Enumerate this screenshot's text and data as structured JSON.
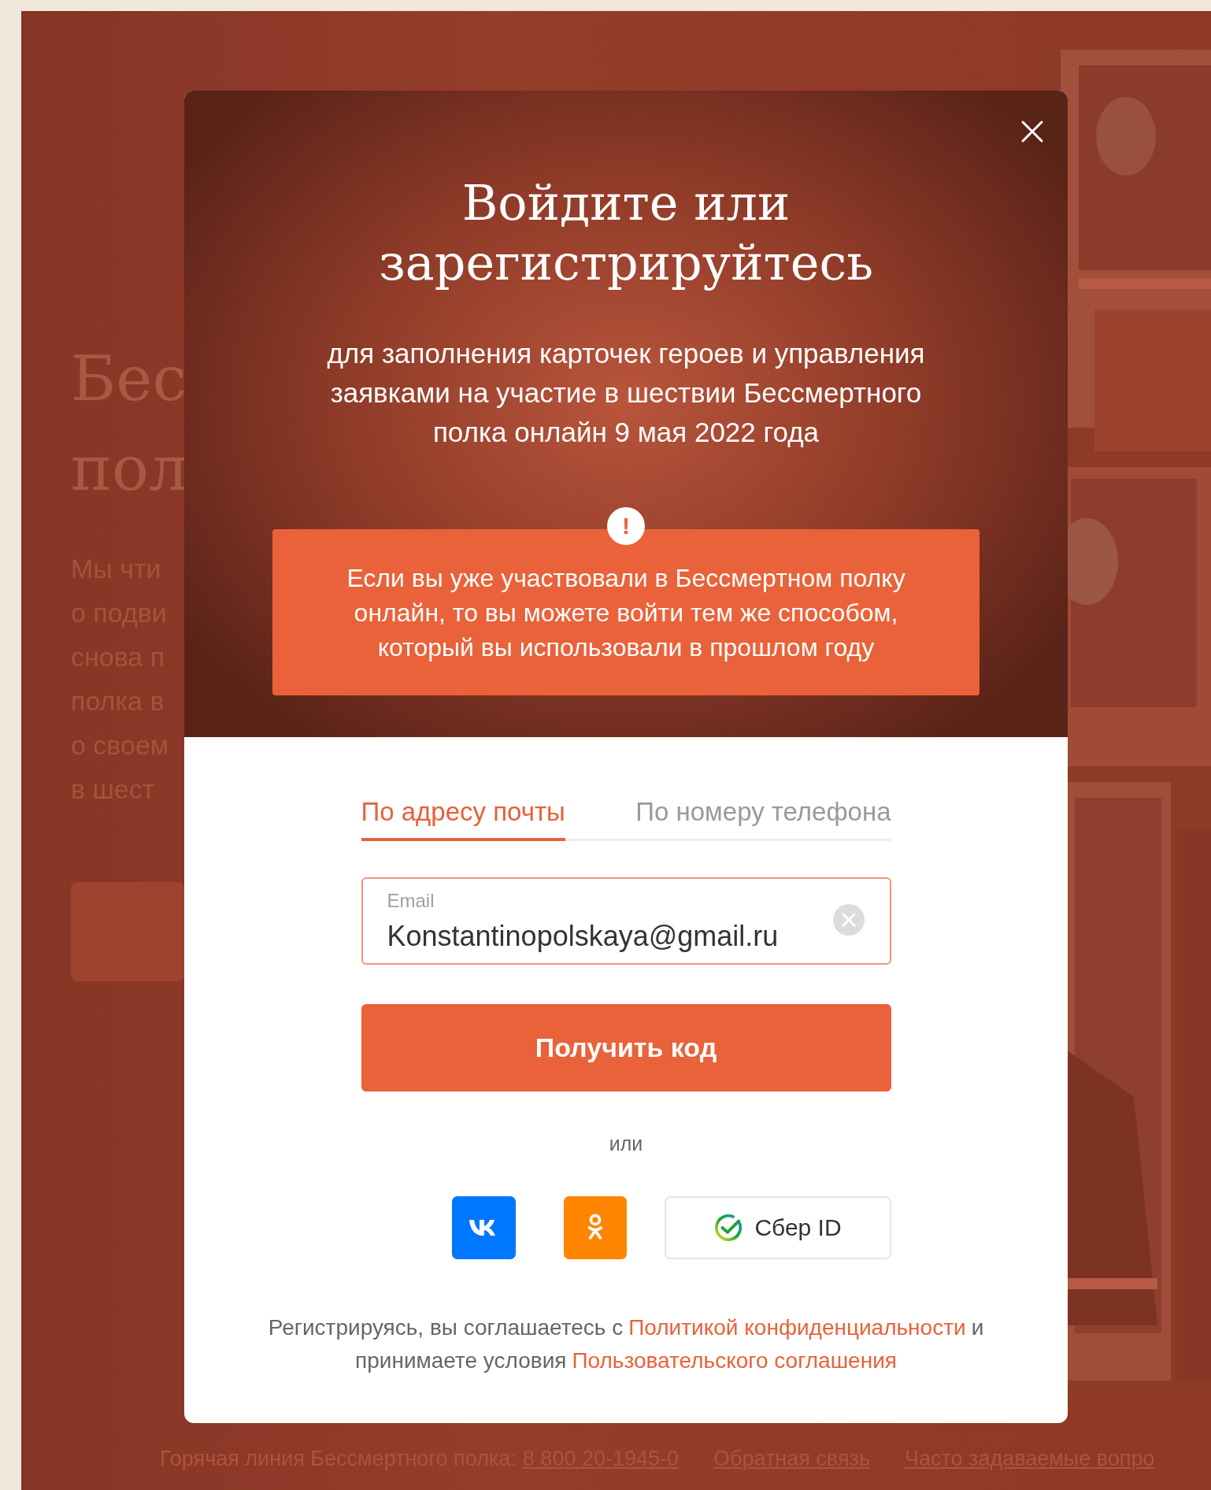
{
  "background": {
    "heading_lines": [
      "Бес",
      "пол"
    ],
    "paragraph_lines": [
      "Мы чти",
      "о подви",
      "снова п",
      "полка в",
      "о своем",
      "в шест"
    ]
  },
  "modal": {
    "title_lines": [
      "Войдите или",
      "зарегистрируйтесь"
    ],
    "subtitle_lines": [
      "для заполнения карточек героев и управления",
      "заявками на участие в шествии Бессмертного",
      "полка онлайн 9 мая 2022 года"
    ],
    "notice": {
      "badge": "!",
      "lines": [
        "Если вы уже участвовали в Бессмертном полку",
        "онлайн, то вы можете войти тем же способом,",
        "который вы использовали в прошлом году"
      ]
    },
    "tabs": [
      {
        "label": "По адресу почты",
        "selected": true
      },
      {
        "label": "По номеру телефона",
        "selected": false
      }
    ],
    "email_field": {
      "label": "Email",
      "value": "Konstantinopolskaya@gmail.ru"
    },
    "submit_button": "Получить код",
    "divider": "или",
    "social": [
      {
        "kind": "vk"
      },
      {
        "kind": "ok"
      },
      {
        "kind": "sber",
        "label": "Сбер ID"
      }
    ],
    "legal_lines": [
      [
        {
          "kind": "text",
          "text": "Регистрируясь, вы соглашаетесь с"
        },
        {
          "kind": "link",
          "text": "Политикой конфиденциальности"
        },
        {
          "kind": "text",
          "text": "и"
        }
      ],
      [
        {
          "kind": "text",
          "text": "принимаете условия"
        },
        {
          "kind": "link",
          "text": "Пользовательского соглашения"
        }
      ]
    ]
  },
  "footer": {
    "hotline_label": "Горячая линия Бессмертного полка:",
    "hotline_phone": "8 800 20-1945-0",
    "links": [
      "Обратная связь",
      "Часто задаваемые вопро"
    ]
  }
}
